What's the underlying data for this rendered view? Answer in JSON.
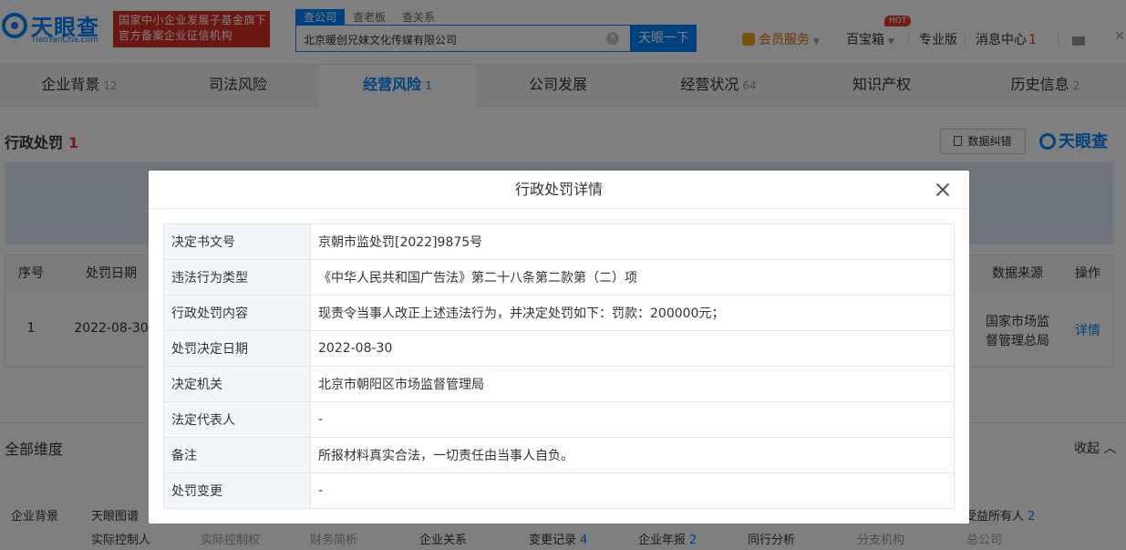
{
  "header": {
    "logo_text": "天眼查",
    "logo_sub": "TianYanCha.com",
    "badge_line1": "国家中小企业发展子基金旗下",
    "badge_line2": "官方备案企业征信机构",
    "search_tabs": [
      "查公司",
      "查老板",
      "查关系"
    ],
    "search_value": "北京暖创兄妹文化传媒有限公司",
    "search_button": "天眼一下",
    "vip_label": "会员服务",
    "baibaoxiang_label": "百宝箱",
    "hot_badge": "HOT",
    "pro_label": "专业版",
    "msg_label": "消息中心",
    "msg_count": "1"
  },
  "nav": {
    "tabs": [
      {
        "label": "企业背景",
        "count": "12"
      },
      {
        "label": "司法风险",
        "count": ""
      },
      {
        "label": "经营风险",
        "count": "1"
      },
      {
        "label": "公司发展",
        "count": ""
      },
      {
        "label": "经营状况",
        "count": "64"
      },
      {
        "label": "知识产权",
        "count": ""
      },
      {
        "label": "历史信息",
        "count": "2"
      }
    ]
  },
  "section": {
    "title": "行政处罚",
    "count": "1",
    "correct_button": "数据纠错",
    "watermark": "天眼查"
  },
  "bg_table": {
    "headers": {
      "no": "序号",
      "date": "处罚日期",
      "source": "数据来源",
      "action": "操作"
    },
    "row": {
      "no": "1",
      "date": "2022-08-30",
      "source_line1": "国家市场监",
      "source_line2": "督管理总局",
      "action": "详情"
    }
  },
  "dimensions": {
    "title": "全部维度",
    "fold": "收起",
    "row1_label": "企业背景",
    "row1_first": "天眼图谱",
    "row1_last": "受益所有人",
    "row1_last_count": "2",
    "row2": [
      {
        "label": "实际控制人",
        "count": "",
        "muted": false
      },
      {
        "label": "实际控制权",
        "count": "",
        "muted": true
      },
      {
        "label": "财务简析",
        "count": "",
        "muted": true
      },
      {
        "label": "企业关系",
        "count": "",
        "muted": false
      },
      {
        "label": "变更记录",
        "count": "4",
        "muted": false
      },
      {
        "label": "企业年报",
        "count": "2",
        "muted": false
      },
      {
        "label": "同行分析",
        "count": "",
        "muted": false
      },
      {
        "label": "分支机构",
        "count": "",
        "muted": true
      },
      {
        "label": "总公司",
        "count": "",
        "muted": true
      }
    ]
  },
  "modal": {
    "title": "行政处罚详情",
    "rows": [
      {
        "key": "决定书文号",
        "value": "京朝市监处罚[2022]9875号"
      },
      {
        "key": "违法行为类型",
        "value": "《中华人民共和国广告法》第二十八条第二款第（二）项"
      },
      {
        "key": "行政处罚内容",
        "value": "现责令当事人改正上述违法行为，并决定处罚如下：罚款：200000元；"
      },
      {
        "key": "处罚决定日期",
        "value": "2022-08-30"
      },
      {
        "key": "决定机关",
        "value": "北京市朝阳区市场监督管理局"
      },
      {
        "key": "法定代表人",
        "value": "-"
      },
      {
        "key": "备注",
        "value": "所报材料真实合法，一切责任由当事人自负。"
      },
      {
        "key": "处罚变更",
        "value": "-"
      }
    ]
  },
  "colors": {
    "brand": "#0084ff",
    "alert": "#e53935",
    "badge": "#d93025"
  }
}
